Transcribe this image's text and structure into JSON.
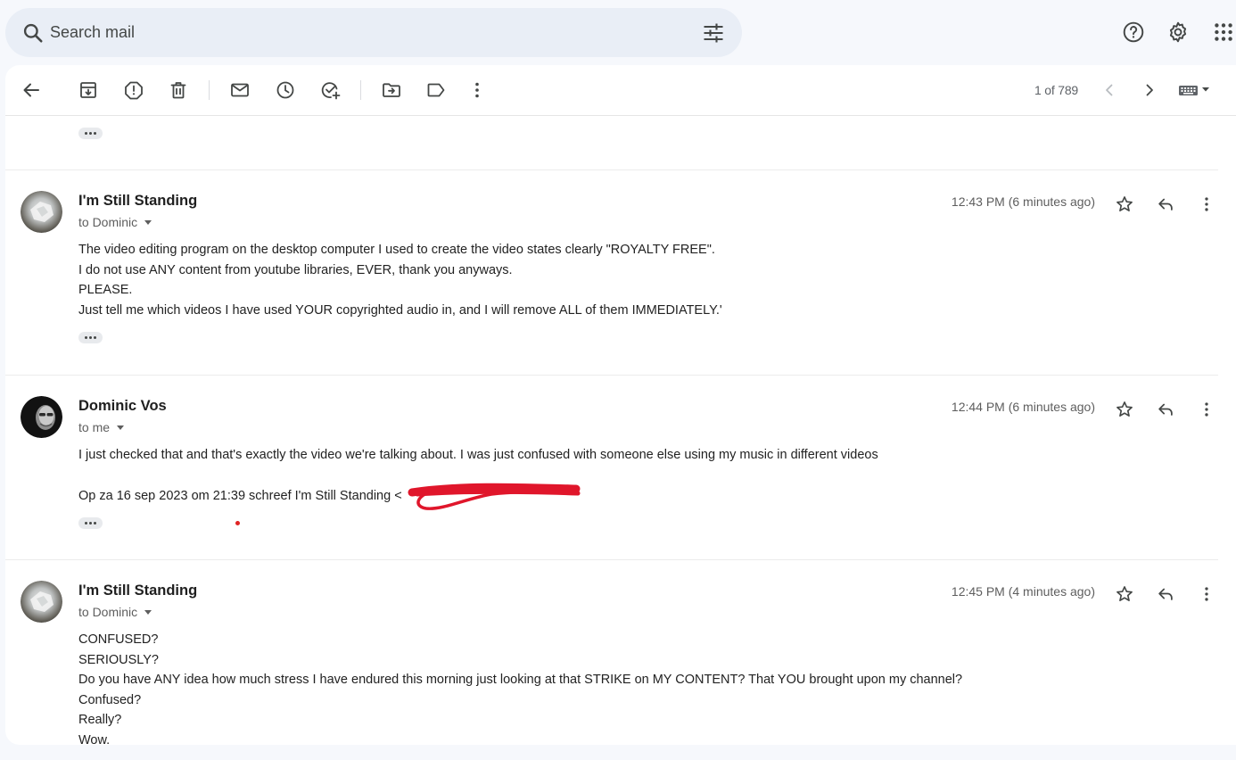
{
  "search": {
    "placeholder": "Search mail"
  },
  "header_icons": [
    "help-icon",
    "settings-icon",
    "apps-icon"
  ],
  "toolbar": {
    "icons": [
      "back-icon",
      "archive-icon",
      "report-spam-icon",
      "delete-icon",
      "mark-unread-icon",
      "snooze-icon",
      "add-to-tasks-icon",
      "move-to-icon",
      "label-icon",
      "more-icon"
    ],
    "pager": "1 of 789"
  },
  "messages": [
    {
      "sender": "I'm Still Standing",
      "recipient": "to Dominic",
      "time": "12:43 PM (6 minutes ago)",
      "body": [
        "The video editing program on the desktop computer I used to create the video states clearly \"ROYALTY FREE\".",
        "I do not use ANY content from youtube libraries, EVER, thank you anyways.",
        "PLEASE.",
        "Just tell me which videos I have used YOUR copyrighted audio in, and I will remove ALL of them IMMEDIATELY.'"
      ]
    },
    {
      "sender": "Dominic Vos",
      "recipient": "to me",
      "time": "12:44 PM (6 minutes ago)",
      "body": [
        "I just checked that and that's exactly the video we're talking about. I was just confused with someone else using my music in different videos"
      ],
      "quote": "Op za 16 sep 2023 om 21:39 schreef I'm Still Standing <"
    },
    {
      "sender": "I'm Still Standing",
      "recipient": "to Dominic",
      "time": "12:45 PM (4 minutes ago)",
      "body": [
        "CONFUSED?",
        "SERIOUSLY?",
        "Do you have ANY idea how much stress I have endured this morning just looking at that STRIKE on MY CONTENT? That YOU brought upon my channel?",
        "Confused?",
        "Really?",
        "Wow."
      ]
    }
  ],
  "colors": {
    "accent_bg": "#e9eef6",
    "redaction": "#e0162b"
  }
}
